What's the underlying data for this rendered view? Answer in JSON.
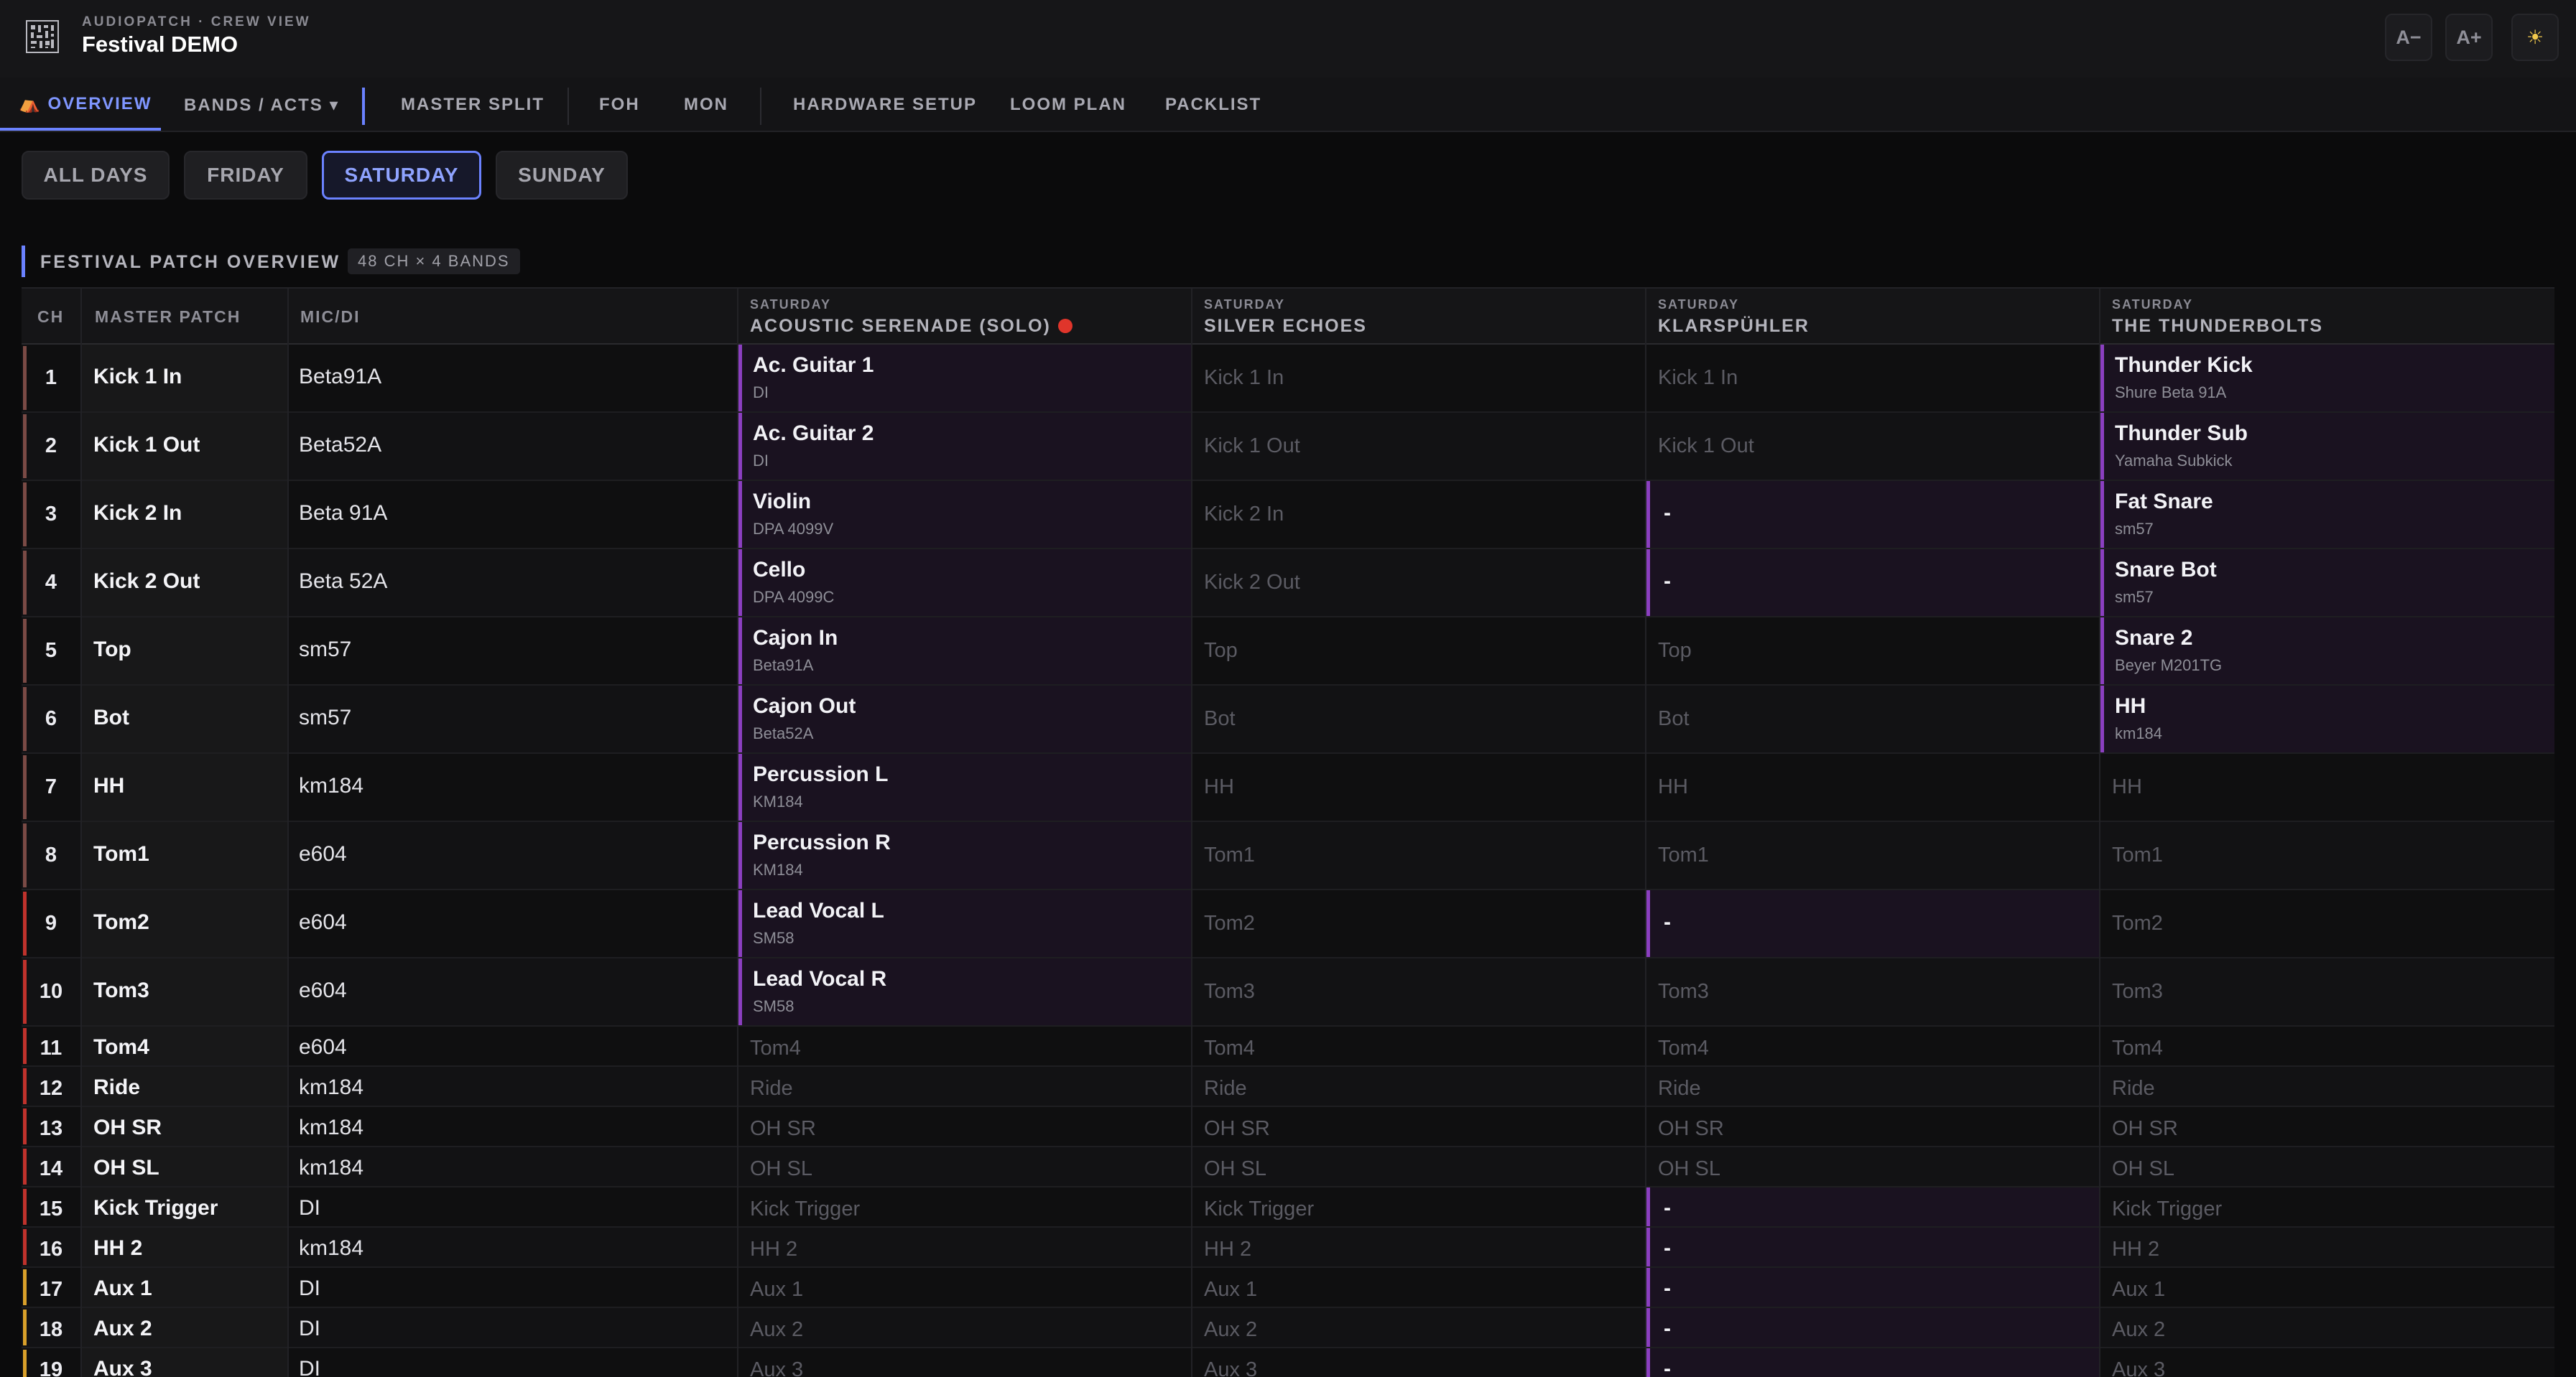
{
  "header": {
    "eyebrow": "AUDIOPATCH · CREW VIEW",
    "title": "Festival DEMO",
    "font_smaller_label": "A−",
    "font_larger_label": "A+",
    "theme_toggle_label": "☀"
  },
  "nav": {
    "tabs": [
      {
        "label": "⛺ OVERVIEW",
        "active": true
      },
      {
        "label": "BANDS / ACTS ▾"
      },
      {
        "label": "MASTER SPLIT"
      },
      {
        "label": "FOH"
      },
      {
        "label": "MON"
      },
      {
        "label": "HARDWARE SETUP"
      },
      {
        "label": "LOOM PLAN"
      },
      {
        "label": "PACKLIST"
      }
    ]
  },
  "day_filter": {
    "options": [
      "ALL DAYS",
      "FRIDAY",
      "SATURDAY",
      "SUNDAY"
    ],
    "selected": "SATURDAY"
  },
  "section": {
    "title": "FESTIVAL PATCH OVERVIEW",
    "badge": "48 CH × 4 BANDS"
  },
  "table": {
    "columns": {
      "ch": "CH",
      "master": "MASTER PATCH",
      "mic": "MIC/DI"
    },
    "bands": [
      {
        "day": "SATURDAY",
        "name": "ACOUSTIC SERENADE (SOLO)",
        "recording": true
      },
      {
        "day": "SATURDAY",
        "name": "SILVER ECHOES"
      },
      {
        "day": "SATURDAY",
        "name": "KLARSPÜHLER"
      },
      {
        "day": "SATURDAY",
        "name": "THE THUNDERBOLTS"
      }
    ],
    "group_colors": {
      "drums_a": "#7a4a45",
      "drums_b": "#c0322c",
      "aux": "#d9a02a"
    },
    "rows": [
      {
        "ch": "1",
        "master": "Kick 1 In",
        "mic": "Beta91A",
        "group": "drums_a",
        "cells": [
          {
            "n": "Ac. Guitar 1",
            "s": "DI"
          },
          {
            "g": "Kick 1 In"
          },
          {
            "g": "Kick 1 In"
          },
          {
            "n": "Thunder Kick",
            "s": "Shure Beta 91A"
          }
        ]
      },
      {
        "ch": "2",
        "master": "Kick 1 Out",
        "mic": "Beta52A",
        "group": "drums_a",
        "cells": [
          {
            "n": "Ac. Guitar 2",
            "s": "DI"
          },
          {
            "g": "Kick 1 Out"
          },
          {
            "g": "Kick 1 Out"
          },
          {
            "n": "Thunder Sub",
            "s": "Yamaha Subkick"
          }
        ]
      },
      {
        "ch": "3",
        "master": "Kick 2 In",
        "mic": "Beta 91A",
        "group": "drums_a",
        "cells": [
          {
            "n": "Violin",
            "s": "DPA 4099V"
          },
          {
            "g": "Kick 2 In"
          },
          {
            "d": "-"
          },
          {
            "n": "Fat Snare",
            "s": "sm57"
          }
        ]
      },
      {
        "ch": "4",
        "master": "Kick 2 Out",
        "mic": "Beta 52A",
        "group": "drums_a",
        "cells": [
          {
            "n": "Cello",
            "s": "DPA 4099C"
          },
          {
            "g": "Kick 2 Out"
          },
          {
            "d": "-"
          },
          {
            "n": "Snare Bot",
            "s": "sm57"
          }
        ]
      },
      {
        "ch": "5",
        "master": "Top",
        "mic": "sm57",
        "group": "drums_a",
        "cells": [
          {
            "n": "Cajon In",
            "s": "Beta91A"
          },
          {
            "g": "Top"
          },
          {
            "g": "Top"
          },
          {
            "n": "Snare 2",
            "s": "Beyer M201TG"
          }
        ]
      },
      {
        "ch": "6",
        "master": "Bot",
        "mic": "sm57",
        "group": "drums_a",
        "cells": [
          {
            "n": "Cajon Out",
            "s": "Beta52A"
          },
          {
            "g": "Bot"
          },
          {
            "g": "Bot"
          },
          {
            "n": "HH",
            "s": "km184"
          }
        ]
      },
      {
        "ch": "7",
        "master": "HH",
        "mic": "km184",
        "group": "drums_a",
        "cells": [
          {
            "n": "Percussion L",
            "s": "KM184"
          },
          {
            "g": "HH"
          },
          {
            "g": "HH"
          },
          {
            "g": "HH"
          }
        ]
      },
      {
        "ch": "8",
        "master": "Tom1",
        "mic": "e604",
        "group": "drums_a",
        "cells": [
          {
            "n": "Percussion R",
            "s": "KM184"
          },
          {
            "g": "Tom1"
          },
          {
            "g": "Tom1"
          },
          {
            "g": "Tom1"
          }
        ]
      },
      {
        "ch": "9",
        "master": "Tom2",
        "mic": "e604",
        "group": "drums_b",
        "cells": [
          {
            "n": "Lead Vocal L",
            "s": "SM58"
          },
          {
            "g": "Tom2"
          },
          {
            "d": "-"
          },
          {
            "g": "Tom2"
          }
        ]
      },
      {
        "ch": "10",
        "master": "Tom3",
        "mic": "e604",
        "group": "drums_b",
        "cells": [
          {
            "n": "Lead Vocal R",
            "s": "SM58"
          },
          {
            "g": "Tom3"
          },
          {
            "g": "Tom3"
          },
          {
            "g": "Tom3"
          }
        ]
      },
      {
        "ch": "11",
        "master": "Tom4",
        "mic": "e604",
        "group": "drums_b",
        "cells": [
          {
            "g": "Tom4"
          },
          {
            "g": "Tom4"
          },
          {
            "g": "Tom4"
          },
          {
            "g": "Tom4"
          }
        ]
      },
      {
        "ch": "12",
        "master": "Ride",
        "mic": "km184",
        "group": "drums_b",
        "cells": [
          {
            "g": "Ride"
          },
          {
            "g": "Ride"
          },
          {
            "g": "Ride"
          },
          {
            "g": "Ride"
          }
        ]
      },
      {
        "ch": "13",
        "master": "OH SR",
        "mic": "km184",
        "group": "drums_b",
        "cells": [
          {
            "g": "OH SR"
          },
          {
            "g": "OH SR"
          },
          {
            "g": "OH SR"
          },
          {
            "g": "OH SR"
          }
        ]
      },
      {
        "ch": "14",
        "master": "OH SL",
        "mic": "km184",
        "group": "drums_b",
        "cells": [
          {
            "g": "OH SL"
          },
          {
            "g": "OH SL"
          },
          {
            "g": "OH SL"
          },
          {
            "g": "OH SL"
          }
        ]
      },
      {
        "ch": "15",
        "master": "Kick Trigger",
        "mic": "DI",
        "group": "drums_b",
        "cells": [
          {
            "g": "Kick Trigger"
          },
          {
            "g": "Kick Trigger"
          },
          {
            "d": "-"
          },
          {
            "g": "Kick Trigger"
          }
        ]
      },
      {
        "ch": "16",
        "master": "HH 2",
        "mic": "km184",
        "group": "drums_b",
        "cells": [
          {
            "g": "HH 2"
          },
          {
            "g": "HH 2"
          },
          {
            "d": "-"
          },
          {
            "g": "HH 2"
          }
        ]
      },
      {
        "ch": "17",
        "master": "Aux 1",
        "mic": "DI",
        "group": "aux",
        "cells": [
          {
            "g": "Aux 1"
          },
          {
            "g": "Aux 1"
          },
          {
            "d": "-"
          },
          {
            "g": "Aux 1"
          }
        ]
      },
      {
        "ch": "18",
        "master": "Aux 2",
        "mic": "DI",
        "group": "aux",
        "cells": [
          {
            "g": "Aux 2"
          },
          {
            "g": "Aux 2"
          },
          {
            "d": "-"
          },
          {
            "g": "Aux 2"
          }
        ]
      },
      {
        "ch": "19",
        "master": "Aux 3",
        "mic": "DI",
        "group": "aux",
        "cells": [
          {
            "g": "Aux 3"
          },
          {
            "g": "Aux 3"
          },
          {
            "d": "-"
          },
          {
            "g": "Aux 3"
          }
        ]
      }
    ]
  }
}
